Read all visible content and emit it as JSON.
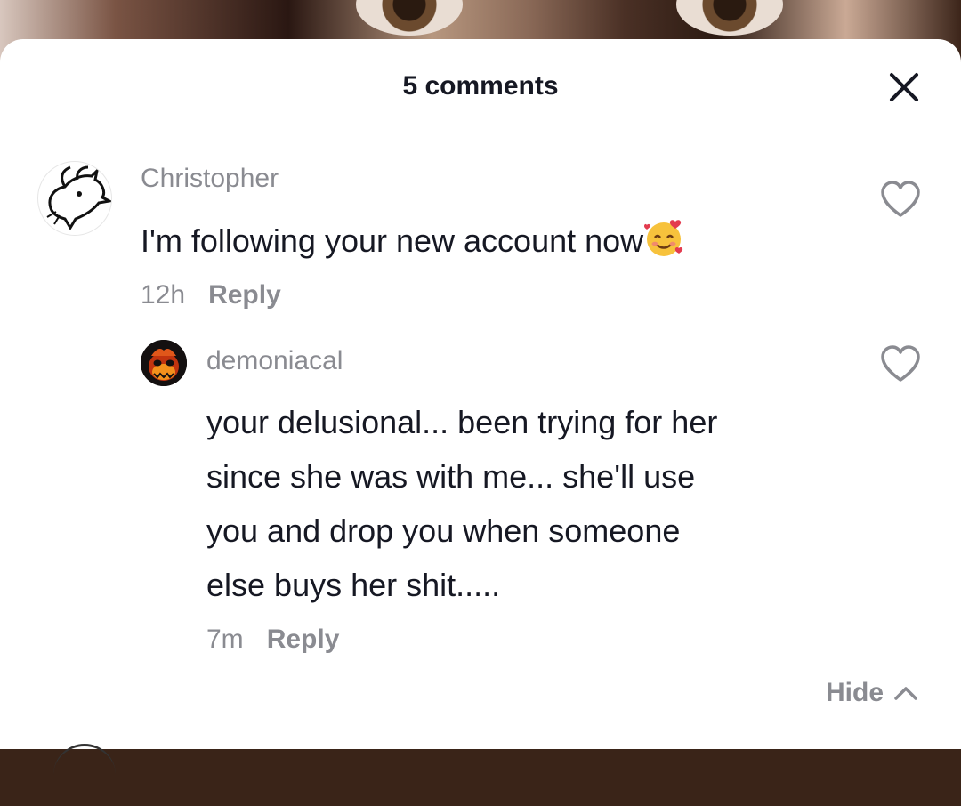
{
  "header": {
    "title": "5 comments",
    "close_icon": "close-icon"
  },
  "comments": [
    {
      "username": "Christopher",
      "avatar_icon": "goat-avatar",
      "text": "I'm following your new account now",
      "emoji": "smiling-face-with-hearts-emoji",
      "time": "12h",
      "reply_label": "Reply",
      "like_icon": "heart-outline-icon"
    },
    {
      "username": "demoniacal",
      "avatar_icon": "flaming-skull-avatar",
      "text_lines": [
        "your delusional... been trying for her",
        "since she was with me... she'll use",
        "you and drop you when someone",
        "else buys her shit....."
      ],
      "time": "7m",
      "reply_label": "Reply",
      "like_icon": "heart-outline-icon"
    }
  ],
  "hide_label": "Hide",
  "colors": {
    "text_primary": "#161823",
    "text_secondary": "#8a8b91",
    "sheet_background": "#ffffff"
  }
}
